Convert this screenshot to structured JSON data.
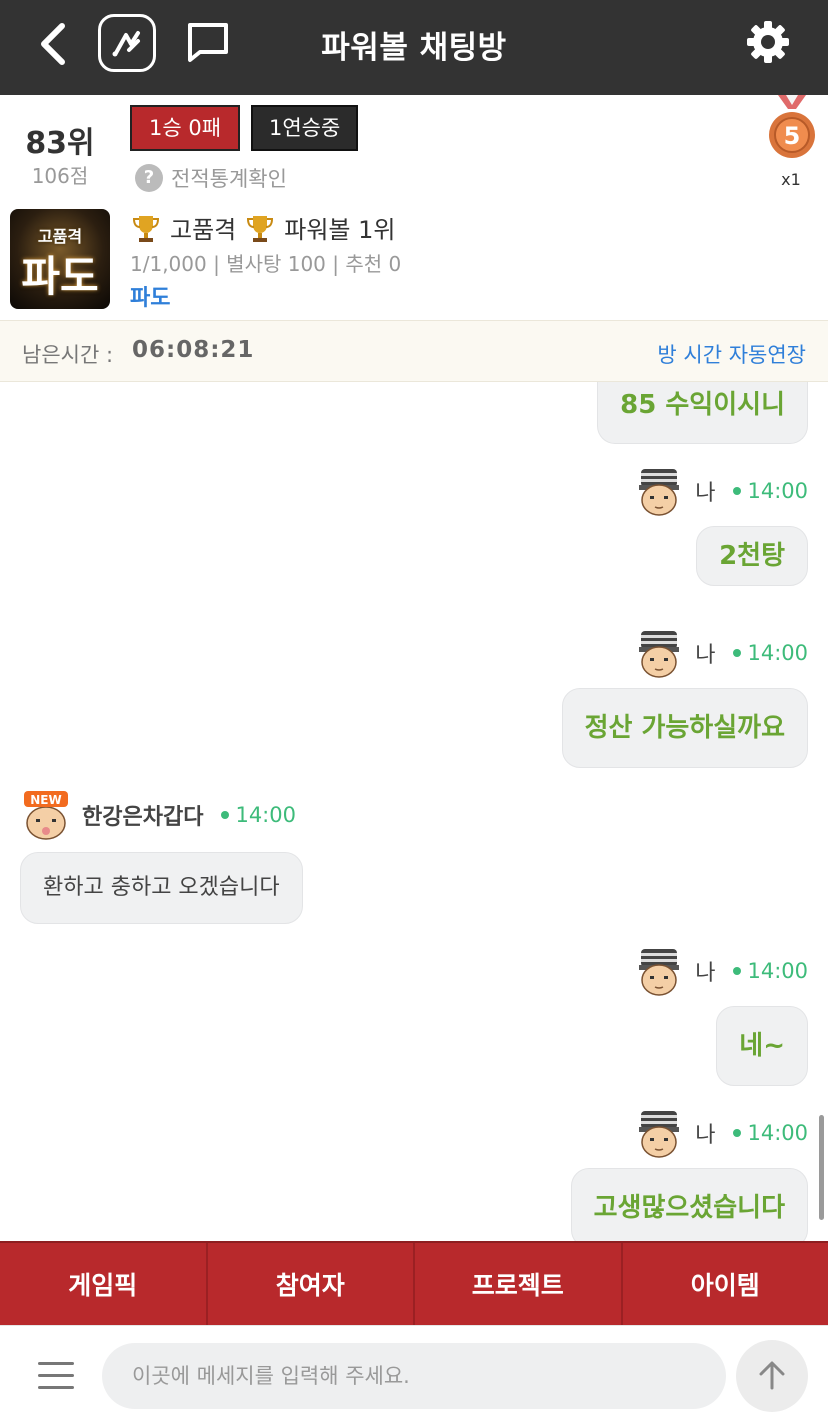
{
  "header": {
    "title": "파워볼 채팅방"
  },
  "profile": {
    "rank": "83위",
    "score": "106점",
    "record": "1승 0패",
    "streak": "1연승중",
    "stats_link": "전적통계확인",
    "medal_number": "5",
    "medal_count": "x1"
  },
  "room": {
    "thumb_top": "고품격",
    "thumb_main": "파도",
    "grade_label": "고품격",
    "grade_rank": "파워볼 1위",
    "meta": "1/1,000 | 별사탕 100 | 추천 0",
    "owner": "파도"
  },
  "timebar": {
    "label": "남은시간 :",
    "value": "06:08:21",
    "extend_link": "방 시간 자동연장"
  },
  "messages": [
    {
      "mine": true,
      "sender": "",
      "time": "",
      "text": "85 수익이시니"
    },
    {
      "mine": true,
      "sender": "나",
      "time": "14:00",
      "text": "2천탕"
    },
    {
      "mine": true,
      "sender": "나",
      "time": "14:00",
      "text": "정산 가능하실까요"
    },
    {
      "mine": false,
      "sender": "한강은차갑다",
      "time": "14:00",
      "text": "환하고 충하고 오겠습니다",
      "avatar_badge": "NEW"
    },
    {
      "mine": true,
      "sender": "나",
      "time": "14:00",
      "text": "네~"
    },
    {
      "mine": true,
      "sender": "나",
      "time": "14:00",
      "text": "고생많으셨습니다"
    }
  ],
  "tabs": [
    {
      "label": "게임픽"
    },
    {
      "label": "참여자"
    },
    {
      "label": "프로젝트"
    },
    {
      "label": "아이템"
    }
  ],
  "input": {
    "placeholder": "이곳에 메세지를 입력해 주세요."
  },
  "colors": {
    "header_bg": "#333333",
    "accent_red": "#b8292c",
    "link_blue": "#2f7fd9",
    "my_message_text": "#6aa534",
    "online_green": "#3dbb7a"
  }
}
